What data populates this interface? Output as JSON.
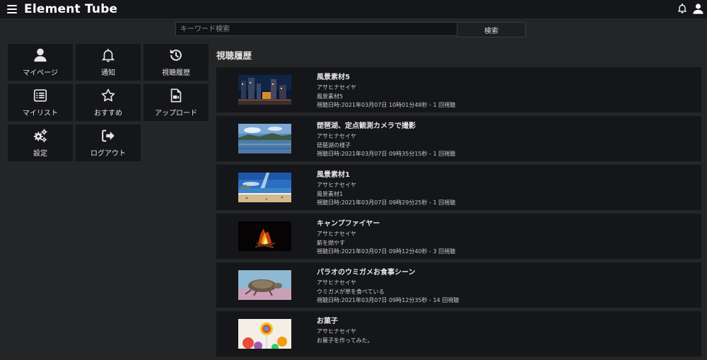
{
  "header": {
    "title": "Element Tube"
  },
  "search": {
    "placeholder": "キーワード検索",
    "value": "",
    "button_label": "検索"
  },
  "menu": [
    {
      "label": "マイページ",
      "icon": "user-icon"
    },
    {
      "label": "通知",
      "icon": "bell-icon"
    },
    {
      "label": "視聴履歴",
      "icon": "history-icon"
    },
    {
      "label": "マイリスト",
      "icon": "list-icon"
    },
    {
      "label": "おすすめ",
      "icon": "star-icon"
    },
    {
      "label": "アップロード",
      "icon": "file-video-icon"
    },
    {
      "label": "設定",
      "icon": "gears-icon"
    },
    {
      "label": "ログアウト",
      "icon": "sign-out-icon"
    }
  ],
  "history": {
    "title": "視聴履歴",
    "items": [
      {
        "title": "風景素材5",
        "author": "アサヒナセイヤ",
        "description": "風景素材5",
        "watched": "視聴日時:2021年03月07日 10時01分48秒 - 1 回視聴"
      },
      {
        "title": "琵琶湖、定点観測カメラで撮影",
        "author": "アサヒナセイヤ",
        "description": "琵琶湖の様子",
        "watched": "視聴日時:2021年03月07日 09時35分15秒 - 1 回視聴"
      },
      {
        "title": "風景素材1",
        "author": "アサヒナセイヤ",
        "description": "風景素材1",
        "watched": "視聴日時:2021年03月07日 09時29分25秒 - 1 回視聴"
      },
      {
        "title": "キャンプファイヤー",
        "author": "アサヒナセイヤ",
        "description": "薪を燃やす",
        "watched": "視聴日時:2021年03月07日 09時12分40秒 - 3 回視聴"
      },
      {
        "title": "パラオのウミガメお食事シーン",
        "author": "アサヒナセイヤ",
        "description": "ウミガメが草を食べている",
        "watched": "視聴日時:2021年03月07日 09時12分35秒 - 14 回視聴"
      },
      {
        "title": "お菓子",
        "author": "アサヒナセイヤ",
        "description": "お菓子を作ってみた。",
        "watched": ""
      }
    ]
  },
  "colors": {
    "background": "#242527",
    "panel": "#151619",
    "text": "#e6e6e6"
  }
}
